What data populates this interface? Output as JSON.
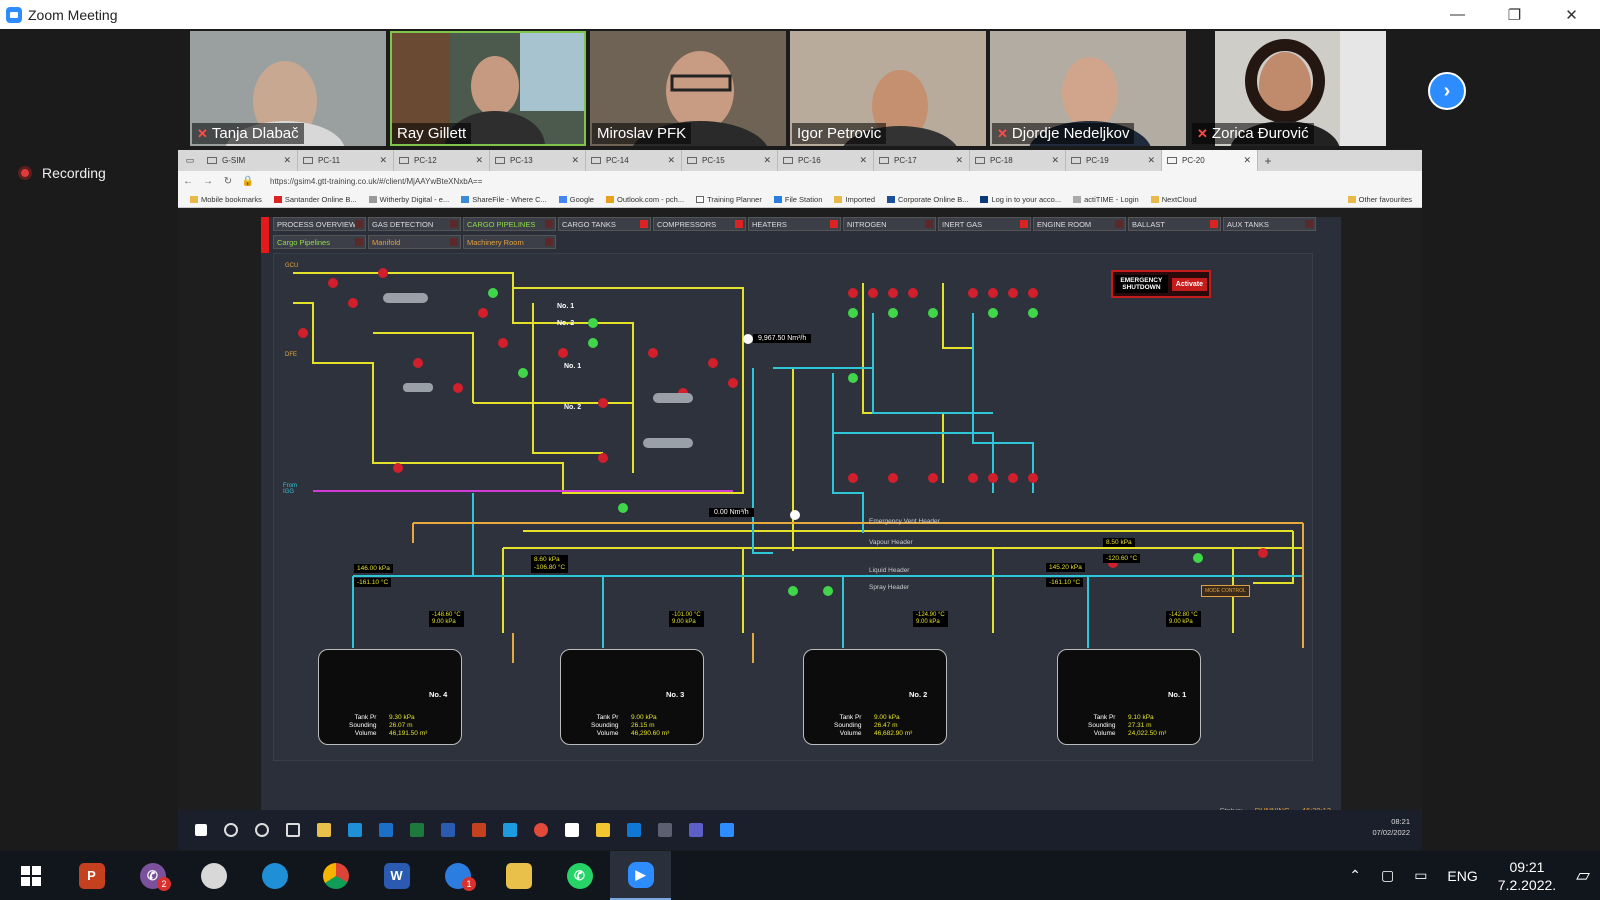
{
  "window": {
    "title": "Zoom Meeting",
    "minimize": "—",
    "maximize": "❐",
    "close": "✕"
  },
  "participants": [
    {
      "name": "Tanja Dlabač",
      "muted": true,
      "bg": "#8b8f8e"
    },
    {
      "name": "Ray Gillett",
      "muted": false,
      "bg": "#5e6b62"
    },
    {
      "name": "Miroslav PFK",
      "muted": false,
      "bg": "#7a6a5a"
    },
    {
      "name": "Igor Petrovic",
      "muted": false,
      "bg": "#a89a8c"
    },
    {
      "name": "Djordje Nedeljkov",
      "muted": true,
      "bg": "#b0a9a0"
    },
    {
      "name": "Zorica Đurović",
      "muted": true,
      "bg": "#c4c2bd"
    }
  ],
  "recording": {
    "label": "Recording"
  },
  "browser": {
    "tabs": [
      "G-SIM",
      "PC-11",
      "PC-12",
      "PC-13",
      "PC-14",
      "PC-15",
      "PC-16",
      "PC-17",
      "PC-18",
      "PC-19",
      "PC-20"
    ],
    "active_tab": "PC-20",
    "url": "https://gsim4.gtt-training.co.uk/#/client/MjAAYwBteXNxbA==",
    "bookmarks": [
      "Mobile bookmarks",
      "Santander Online B...",
      "Witherby Digital - e...",
      "ShareFile - Where C...",
      "Google",
      "Outlook.com - pch...",
      "Training Planner",
      "File Station",
      "Imported",
      "Corporate Online B...",
      "Log in to your acco...",
      "actiTIME - Login",
      "NextCloud"
    ],
    "other_favourites": "Other favourites"
  },
  "app": {
    "menu_row1": [
      "PROCESS OVERVIEW",
      "GAS DETECTION",
      "CARGO PIPELINES",
      "CARGO TANKS",
      "COMPRESSORS",
      "HEATERS",
      "NITROGEN",
      "INERT GAS",
      "ENGINE ROOM",
      "BALLAST",
      "AUX TANKS"
    ],
    "menu_row2": [
      "Cargo Pipelines",
      "Manifold",
      "Machinery Room"
    ],
    "esd_label": "EMERGENCY SHUTDOWN",
    "esd_activate": "Activate",
    "status_label": "Status:",
    "status_value": "RUNNING",
    "status_time": "46:39:13",
    "flow_1": "9,967.50 Nm³/h",
    "flow_2": "0.00 Nm³/h",
    "headers": [
      "Emergency Vent Header",
      "Vapour Header",
      "Liquid Header",
      "Spray Header"
    ],
    "readouts": {
      "r1a": "8.60 kPa",
      "r1b": "-106.80 °C",
      "r2a": "146.00 kPa",
      "r2b": "-161.10 °C",
      "r3a": "145.20 kPa",
      "r3b": "-161.10 °C",
      "r4a": "8.50 kPa",
      "r4b": "-120.60 °C"
    },
    "tanks": [
      {
        "name": "No. 4",
        "pr": "9.30 kPa",
        "sounding": "26.07 m",
        "volume": "46,191.50 m³",
        "temp": "-148.60 °C",
        "tpr": "9.00 kPa"
      },
      {
        "name": "No. 3",
        "pr": "9.00 kPa",
        "sounding": "26.15 m",
        "volume": "46,290.60 m³",
        "temp": "-101.00 °C",
        "tpr": "9.00 kPa"
      },
      {
        "name": "No. 2",
        "pr": "9.00 kPa",
        "sounding": "26.47 m",
        "volume": "46,682.90 m³",
        "temp": "-124.90 °C",
        "tpr": "9.00 kPa"
      },
      {
        "name": "No. 1",
        "pr": "9.10 kPa",
        "sounding": "27.31 m",
        "volume": "24,022.50 m³",
        "temp": "-142.80 °C",
        "tpr": "9.00 kPa"
      }
    ],
    "tank_labels": {
      "pr": "Tank Pr",
      "sounding": "Sounding",
      "volume": "Volume"
    },
    "compressors": [
      "No. 1",
      "No. 2"
    ],
    "heaters": [
      "No. 1",
      "No. 2"
    ],
    "gcu": "GCU",
    "dfe": "DFE",
    "from_igg": "From IGG",
    "mode_control": "MODE CONTROL"
  },
  "inner_clock": {
    "time": "08:21",
    "date": "07/02/2022"
  },
  "taskbar": {
    "lang": "ENG",
    "time": "09:21",
    "date": "7.2.2022.",
    "badges": {
      "viber": "2",
      "thunderbird": "1"
    }
  },
  "colors": {
    "liquid": "#2fc7d8",
    "vapour": "#e4e12b",
    "purple": "#d23ad6",
    "spray": "#e6a93c",
    "valve_red": "#d21f2c",
    "valve_green": "#41d64a"
  }
}
